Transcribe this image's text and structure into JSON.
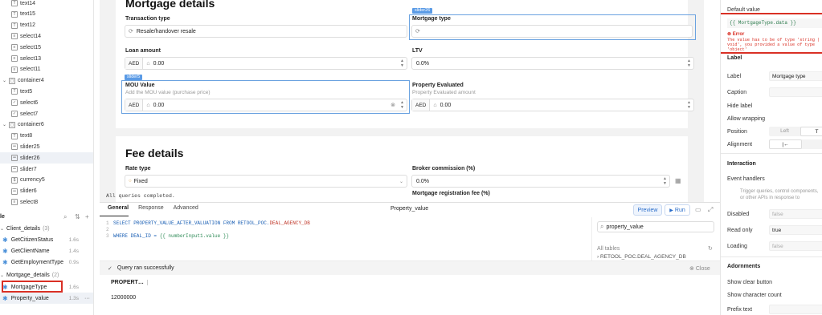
{
  "tree": {
    "items": [
      {
        "label": "text14",
        "icon": "text-icon"
      },
      {
        "label": "text15",
        "icon": "text-icon"
      },
      {
        "label": "text12",
        "icon": "text-icon"
      },
      {
        "label": "select14",
        "icon": "select-icon"
      },
      {
        "label": "select15",
        "icon": "select-icon"
      },
      {
        "label": "select13",
        "icon": "select-icon"
      },
      {
        "label": "select11",
        "icon": "select-icon"
      },
      {
        "label": "container4",
        "icon": "container-icon",
        "group": true
      },
      {
        "label": "text5",
        "icon": "text-icon"
      },
      {
        "label": "select6",
        "icon": "checkbox-icon"
      },
      {
        "label": "select7",
        "icon": "checkbox-icon"
      },
      {
        "label": "container6",
        "icon": "container-icon",
        "group": true
      },
      {
        "label": "text8",
        "icon": "text-icon"
      },
      {
        "label": "slider25",
        "icon": "slider-icon"
      },
      {
        "label": "slider26",
        "icon": "slider-icon",
        "selected": true
      },
      {
        "label": "slider7",
        "icon": "slider-icon"
      },
      {
        "label": "currency5",
        "icon": "currency-icon"
      },
      {
        "label": "slider6",
        "icon": "slider-icon"
      },
      {
        "label": "select8",
        "icon": "select-icon"
      }
    ]
  },
  "canvas": {
    "mortgage_title": "Mortgage details",
    "transaction_type_label": "Transaction type",
    "transaction_type_value": "Resale/handover resale",
    "mortgage_type_label": "Mortgage type",
    "mortgage_type_tag": "slider26",
    "loan_amount_label": "Loan amount",
    "loan_amount_prefix": "AED",
    "loan_amount_value": "0.00",
    "ltv_label": "LTV",
    "ltv_value": "0.0%",
    "mou_tag": "slider5",
    "mou_label": "MOU Value",
    "mou_sub": "Add the MOU value (purchase price)",
    "mou_prefix": "AED",
    "mou_value": "0.00",
    "prop_eval_label": "Property Evaluated",
    "prop_eval_sub": "Property Evaluated amount",
    "prop_eval_prefix": "AED",
    "prop_eval_value": "0.00",
    "fee_title": "Fee details",
    "rate_type_label": "Rate type",
    "rate_type_value": "Fixed",
    "broker_label": "Broker commission (%)",
    "broker_value": "0.0%",
    "reg_fee_label": "Mortgage registration fee (%)",
    "status_line": "All queries completed."
  },
  "queries": {
    "header": "le",
    "group1": "Client_details",
    "group1_count": "(3)",
    "group2": "Mortgage_details",
    "group2_count": "(2)",
    "items": [
      {
        "name": "GetCitizenStatus",
        "time": "1.6s"
      },
      {
        "name": "GetClientName",
        "time": "1.4s"
      },
      {
        "name": "GetEmploymentType",
        "time": "0.9s"
      },
      {
        "name": "MortgageType",
        "time": "1.6s"
      },
      {
        "name": "Property_value",
        "time": "1.3s"
      }
    ]
  },
  "editor": {
    "tabs": [
      "General",
      "Response",
      "Advanced"
    ],
    "query_name": "Property_value",
    "preview_label": "Preview",
    "run_label": "Run",
    "line1_num": "1",
    "line2_num": "2",
    "line3_num": "3",
    "sql_select": "SELECT PROPERTY_VALUE_AFTER_VALUATION FROM RETOOL_POC.",
    "sql_table": "DEAL_AGENCY_DB",
    "sql_where": "WHERE DEAL_ID = ",
    "sql_tpl": "{{ numberInput1.value }}",
    "search_value": "property_value",
    "all_tables": "All tables",
    "table_entry": "RETOOL_POC.DEAL_AGENCY_DB",
    "success": "Query ran successfully",
    "close": "Close",
    "col_header": "PROPERT…",
    "cell_value": "12000000"
  },
  "inspector": {
    "default_value_label": "Default value",
    "default_value_code": "{{ MortgageType.data }}",
    "error_title": "Error",
    "error_msg": "The value has to be of type 'string | void', you provided a value of type 'object'",
    "label_section": "Label",
    "label_label": "Label",
    "label_value": "Mortgage type",
    "caption_label": "Caption",
    "hide_label": "Hide label",
    "allow_wrapping": "Allow wrapping",
    "position_label": "Position",
    "position_left": "Left",
    "position_top": "T",
    "alignment_label": "Alignment",
    "interaction_section": "Interaction",
    "event_handlers": "Event handlers",
    "event_hint": "Trigger queries, control components, or other APIs in response to component ev…",
    "disabled_label": "Disabled",
    "disabled_value": "false",
    "readonly_label": "Read only",
    "readonly_value": "true",
    "loading_label": "Loading",
    "loading_value": "false",
    "adornments_section": "Adornments",
    "show_clear": "Show clear button",
    "show_char_count": "Show character count",
    "prefix_text": "Prefix text",
    "error_color": "#d93025",
    "accent_color": "#4a90d9"
  }
}
